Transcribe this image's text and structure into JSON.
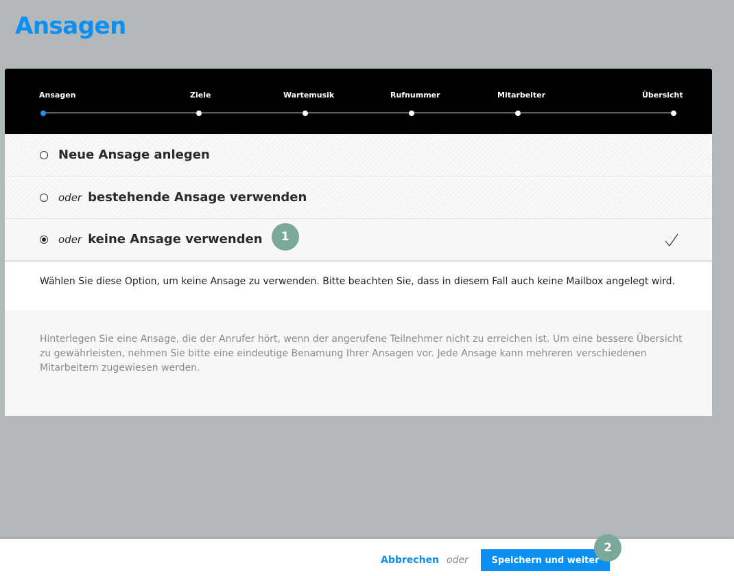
{
  "page": {
    "title": "Ansagen"
  },
  "stepper": {
    "steps": [
      "Ansagen",
      "Ziele",
      "Wartemusik",
      "Rufnummer",
      "Mitarbeiter",
      "Übersicht"
    ],
    "active_index": 0
  },
  "options": [
    {
      "prefix": "",
      "label": "Neue Ansage anlegen",
      "selected": false
    },
    {
      "prefix": "oder",
      "label": "bestehende Ansage verwenden",
      "selected": false
    },
    {
      "prefix": "oder",
      "label": "keine Ansage verwenden",
      "selected": true
    }
  ],
  "badges": {
    "first": "1",
    "second": "2"
  },
  "hint": "Wählen Sie diese Option, um keine Ansage zu verwenden. Bitte beachten Sie, dass in diesem Fall auch keine Mailbox angelegt wird.",
  "info": "Hinterlegen Sie eine Ansage, die der Anrufer hört, wenn der angerufene Teilnehmer nicht zu erreichen ist. Um eine bessere Übersicht zu gewährleisten, nehmen Sie bitte eine eindeutige Benamung Ihrer Ansagen vor. Jede Ansage kann mehreren verschiedenen Mitarbeitern zugewiesen werden.",
  "footer": {
    "cancel_label": "Abbrechen",
    "or_label": "oder",
    "save_label": "Speichern und weiter"
  },
  "colors": {
    "accent": "#0a8ff2",
    "badge": "#7aa89a",
    "stepper_bg": "#000000"
  },
  "icons": {
    "selected_check": "checkmark-icon"
  }
}
